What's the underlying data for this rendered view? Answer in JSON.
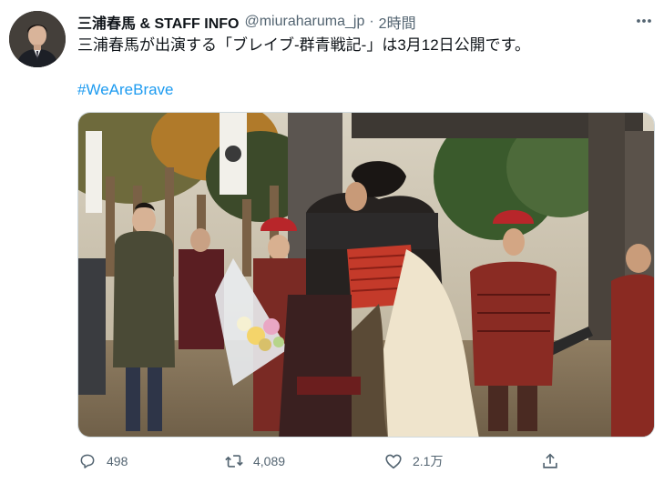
{
  "tweet": {
    "display_name": "三浦春馬 & STAFF INFO",
    "handle": "@miuraharuma_jp",
    "separator": "·",
    "time": "2時間",
    "text": "三浦春馬が出演する「ブレイブ-群青戦記-」は3月12日公開です。",
    "hashtag": "#WeAreBrave"
  },
  "actions": {
    "reply_count": "498",
    "retweet_count": "4,089",
    "like_count": "2.1万"
  },
  "icons": {
    "more": "more-horizontal-icon",
    "reply": "reply-icon",
    "retweet": "retweet-icon",
    "like": "heart-icon",
    "share": "share-icon"
  },
  "colors": {
    "link": "#1d9bf0",
    "secondary_text": "#536471",
    "primary_text": "#0f1419"
  }
}
